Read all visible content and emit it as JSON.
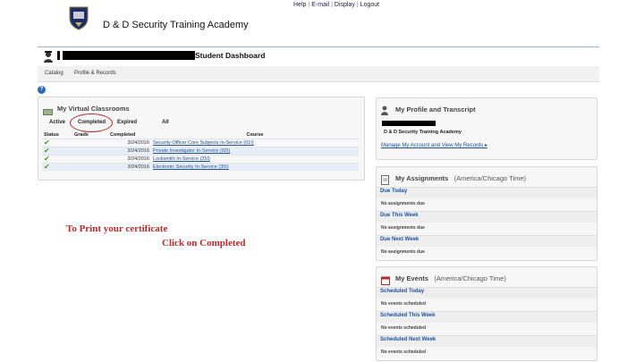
{
  "top_links": [
    "Help",
    "E-mail",
    "Display",
    "Logout"
  ],
  "header": {
    "brand": "D & D Security Training Academy"
  },
  "student": {
    "dashboard_title": "Student Dashboard"
  },
  "nav": {
    "catalog": "Catalog",
    "profile": "Profile & Records"
  },
  "help_glyph": "?",
  "classrooms": {
    "title": "My Virtual Classrooms",
    "tabs": [
      "Active",
      "Completed",
      "Expired",
      "All"
    ],
    "columns": [
      "Status",
      "Grade",
      "Completed",
      "Course"
    ],
    "rows": [
      {
        "completed": "3/24/2016",
        "course": "Security Officer Core Subjects In-Service (01I)"
      },
      {
        "completed": "3/24/2016",
        "course": "Private Investigator In-Service (02I)"
      },
      {
        "completed": "3/24/2016",
        "course": "Locksmith In-Service (25I)"
      },
      {
        "completed": "3/24/2016",
        "course": "Electronic Security In-Service (30I)"
      }
    ]
  },
  "annotation": {
    "line1": "To Print your certificate",
    "line2": "Click on Completed"
  },
  "profile": {
    "title": "My Profile and Transcript",
    "academy": "D & D Security Training Academy",
    "manage_link": "Manage My Account and View My Records ▸"
  },
  "assignments": {
    "title": "My Assignments",
    "tz": "(America/Chicago Time)",
    "sections": [
      {
        "label": "Due Today",
        "empty": "No assignments due"
      },
      {
        "label": "Due This Week",
        "empty": "No assignments due"
      },
      {
        "label": "Due Next Week",
        "empty": "No assignments due"
      }
    ]
  },
  "events": {
    "title": "My Events",
    "tz": "(America/Chicago Time)",
    "sections": [
      {
        "label": "Scheduled Today",
        "empty": "No events scheduled"
      },
      {
        "label": "Scheduled This Week",
        "empty": "No events scheduled"
      },
      {
        "label": "Scheduled Next Week",
        "empty": "No events scheduled"
      }
    ]
  },
  "colors": {
    "accent_red": "#b52a2a",
    "link_blue": "#1f4fa0",
    "check_green": "#3e9a1f"
  }
}
